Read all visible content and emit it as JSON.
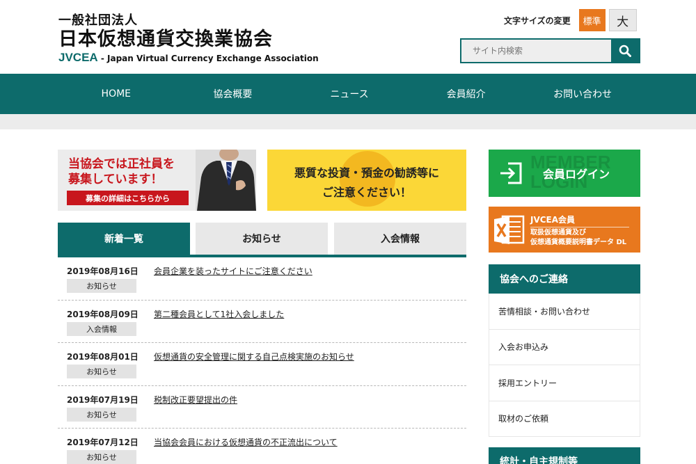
{
  "header": {
    "org_type": "一般社団法人",
    "org_name": "日本仮想通貨交換業協会",
    "abbr": "JVCEA",
    "english_name": "- Japan Virtual Currency Exchange Association"
  },
  "font_size": {
    "label": "文字サイズの変更",
    "standard": "標準",
    "large": "大"
  },
  "search": {
    "placeholder": "サイト内検索",
    "icon": "search-icon"
  },
  "nav": {
    "items": [
      "HOME",
      "協会概要",
      "ニュース",
      "会員紹介",
      "お問い合わせ"
    ]
  },
  "banners": {
    "recruit_line1": "当協会では正社員を",
    "recruit_line2": "募集しています！",
    "recruit_cta": "募集の詳細はこちらから",
    "warn_line1": "悪質な投資・預金の勧誘等に",
    "warn_line2": "ご注意ください！"
  },
  "tabs": [
    {
      "label": "新着一覧",
      "active": true
    },
    {
      "label": "お知らせ",
      "active": false
    },
    {
      "label": "入会情報",
      "active": false
    }
  ],
  "news": [
    {
      "date": "2019年08月16日",
      "category": "お知らせ",
      "title": "会員企業を装ったサイトにご注意ください"
    },
    {
      "date": "2019年08月09日",
      "category": "入会情報",
      "title": "第二種会員として1社入会しました"
    },
    {
      "date": "2019年08月01日",
      "category": "お知らせ",
      "title": "仮想通貨の安全管理に関する自己点検実施のお知らせ"
    },
    {
      "date": "2019年07月19日",
      "category": "お知らせ",
      "title": "税制改正要望提出の件"
    },
    {
      "date": "2019年07月12日",
      "category": "お知らせ",
      "title": "当協会会員における仮想通貨の不正流出について"
    }
  ],
  "sidebar": {
    "login_bg_text_1": "MEMBER",
    "login_bg_text_2": "LOGIN",
    "login_label": "会員ログイン",
    "jvcea_title": "JVCEA会員",
    "jvcea_line1": "取扱仮想通貨及び",
    "jvcea_line2": "仮想通貨概要説明書データ DL",
    "contact_head": "協会へのご連絡",
    "contact_items": [
      "苦情相談・お問い合わせ",
      "入会お申込み",
      "採用エントリー",
      "取材のご依頼"
    ],
    "stats_head": "統計・自主規制等"
  },
  "colors": {
    "brand_teal": "#0d6b6b",
    "accent_orange": "#e8781e",
    "login_green": "#1ba84a",
    "warn_yellow": "#fbd737",
    "recruit_red": "#c8161d"
  }
}
